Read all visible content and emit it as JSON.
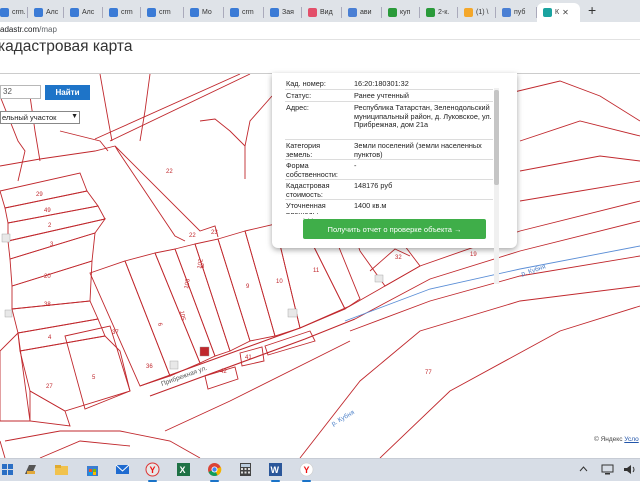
{
  "browser": {
    "tabs": [
      {
        "label": "crm.",
        "color": "#3b7bd6"
      },
      {
        "label": "Алс",
        "color": "#3b7bd6"
      },
      {
        "label": "Алс",
        "color": "#3b7bd6"
      },
      {
        "label": "crm",
        "color": "#3b7bd6"
      },
      {
        "label": "crm",
        "color": "#3b7bd6"
      },
      {
        "label": "Мо",
        "color": "#3b7bd6"
      },
      {
        "label": "crm",
        "color": "#3b7bd6"
      },
      {
        "label": "Зая",
        "color": "#3b7bd6"
      },
      {
        "label": "Вид",
        "color": "#e34f6a"
      },
      {
        "label": "ави",
        "color": "#4a7fd4"
      },
      {
        "label": "куп",
        "color": "#2a9a3a"
      },
      {
        "label": "2-к.",
        "color": "#2a9a3a"
      },
      {
        "label": "(1) \\",
        "color": "#f4a72a"
      },
      {
        "label": "пуб",
        "color": "#4a7fd4"
      },
      {
        "label": "К",
        "color": "#1aa3a0"
      }
    ],
    "active_tab_close": "✕",
    "new_tab": "+",
    "url_domain": "adastr.com",
    "url_path": "/map"
  },
  "page": {
    "title": "кадастровая карта",
    "search_value": "32",
    "find_button": "Найти",
    "object_type": "ельный участок"
  },
  "popup": {
    "rows": [
      {
        "key": "Кад. номер:",
        "value": "16:20:180301:32"
      },
      {
        "key": "Статус:",
        "value": "Ранее учтенный"
      },
      {
        "key": "Адрес:",
        "value": "Республика Татарстан, Зеленодольский муниципальный район, д. Луковское, ул. Прибрежная, дом 21а"
      },
      {
        "key": "Категория земель:",
        "value": "Земли поселений (земли населенных пунктов)"
      },
      {
        "key": "Форма собственности:",
        "value": "-"
      },
      {
        "key": "Кадастровая стоимость:",
        "value": "148176 руб"
      },
      {
        "key": "Уточненная площадь:",
        "value": "1400 кв.м"
      }
    ],
    "report_button": "Получить отчет о проверке объекта →"
  },
  "map": {
    "parcel_labels": [
      "29",
      "49",
      "2",
      "3",
      "20",
      "38",
      "4",
      "27",
      "5",
      "37",
      "36",
      "6",
      "105",
      "103",
      "102",
      "8",
      "9",
      "10",
      "11",
      "22",
      "22",
      "23",
      "41",
      "42",
      "77",
      "19",
      "32"
    ],
    "street_label": "Прибрежная ул.",
    "river_label": "р. Кубня",
    "river_label_2": "р. Кубня",
    "credit_brand": "© Яндекс",
    "credit_link": "Усло"
  },
  "taskbar": {
    "icons": [
      "windows-icon",
      "file-explorer-icon",
      "folder-icon",
      "store-icon",
      "mail-icon",
      "yandex-browser-icon",
      "excel-icon",
      "chrome-icon",
      "calculator-icon",
      "word-icon",
      "yandex-icon"
    ]
  }
}
